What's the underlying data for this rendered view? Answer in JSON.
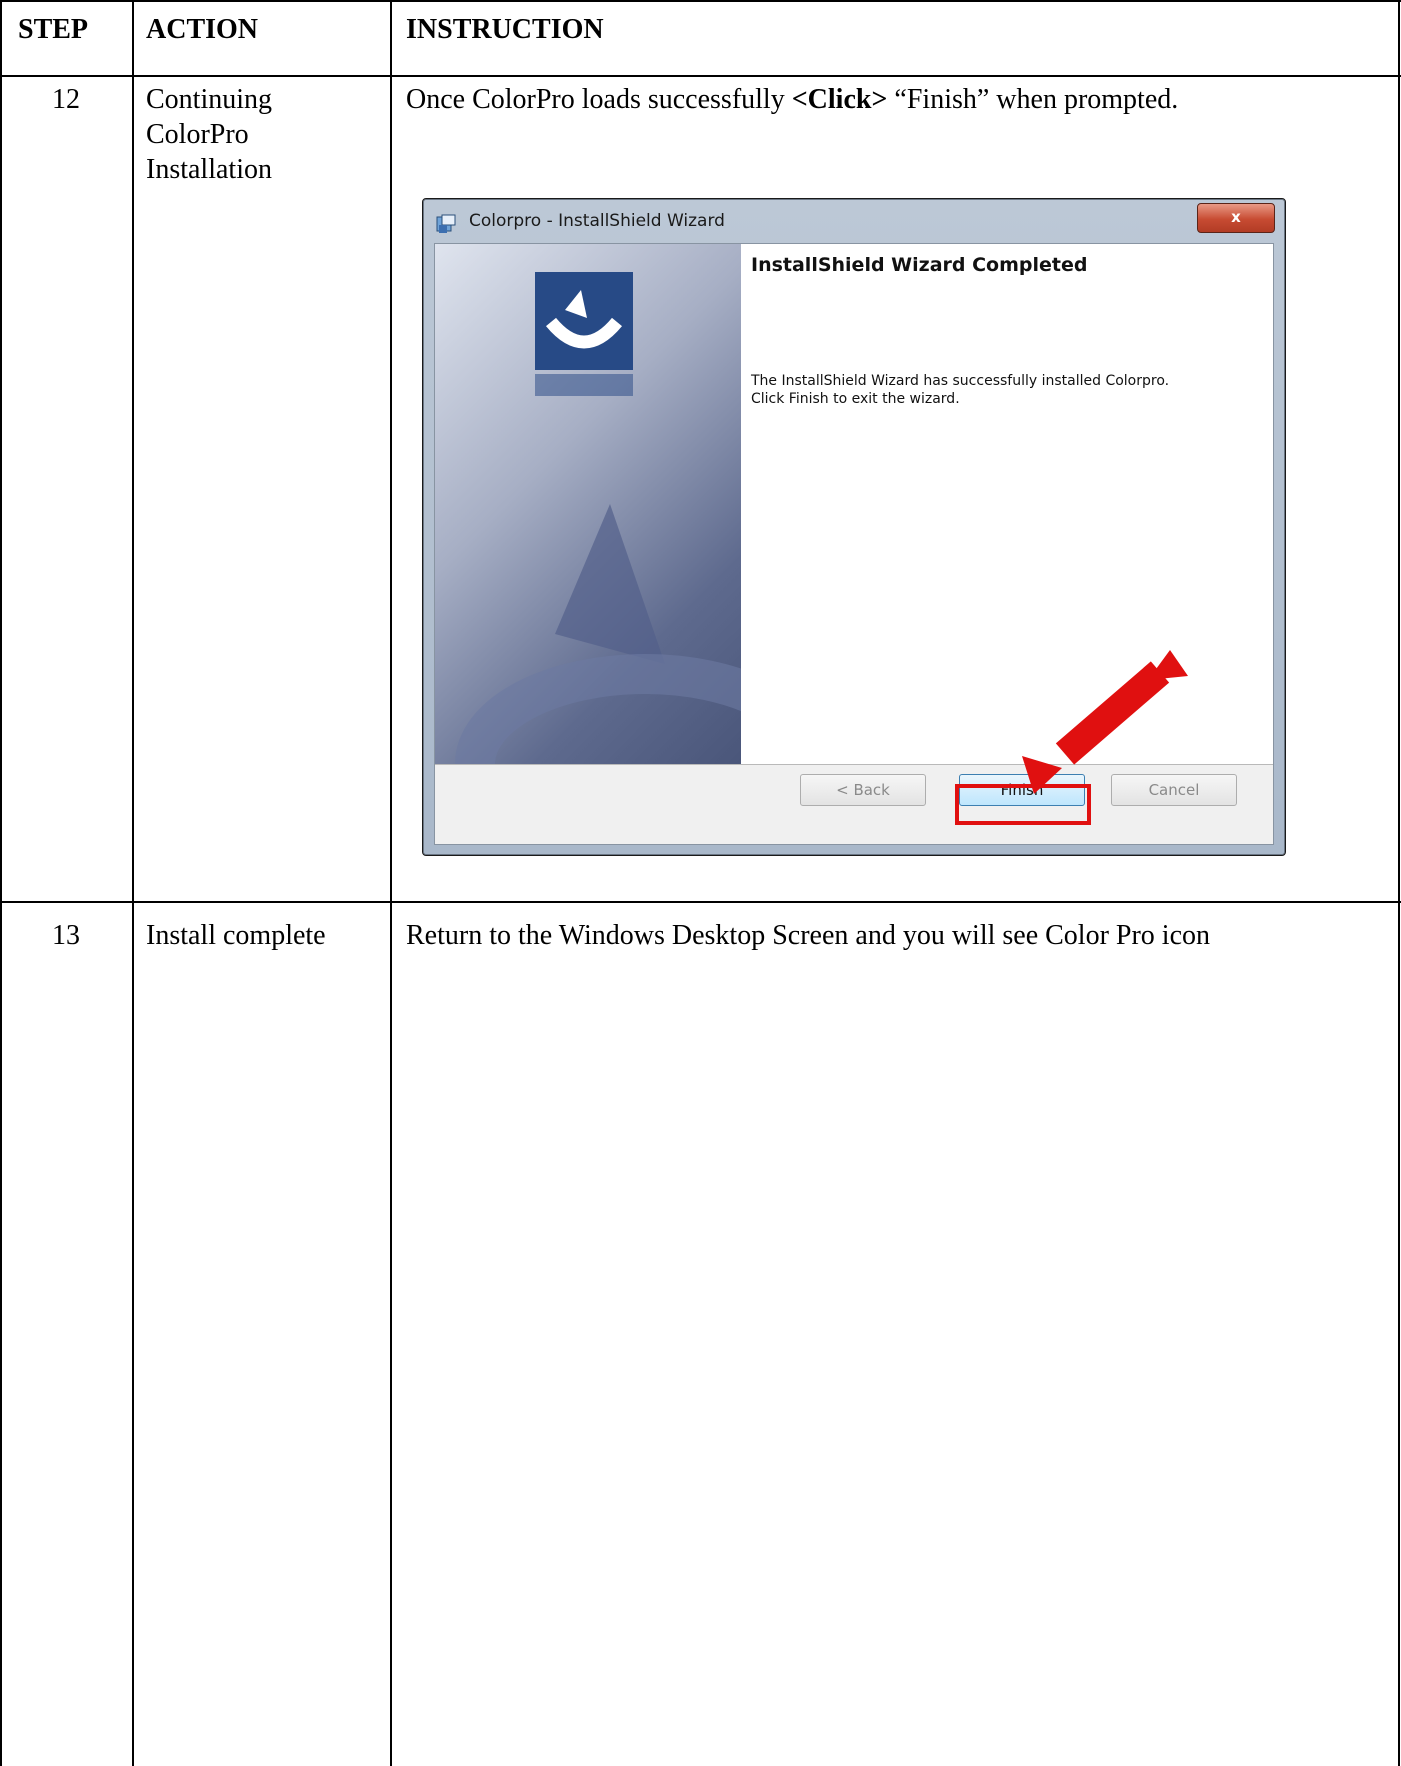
{
  "table": {
    "headers": {
      "step": "STEP",
      "action": "ACTION",
      "instruction": "INSTRUCTION"
    },
    "rows": [
      {
        "step": "12",
        "action_lines": [
          "Continuing",
          "ColorPro",
          "Installation"
        ],
        "instruction_pre": "Once ColorPro loads successfully ",
        "instruction_bold": "<Click>",
        "instruction_post": " “Finish” when prompted."
      },
      {
        "step": "13",
        "action_lines": [
          "Install complete"
        ],
        "instruction": "Return to the Windows Desktop Screen and you will see Color Pro icon"
      }
    ]
  },
  "dialog": {
    "title": "Colorpro - InstallShield Wizard",
    "close_label": "x",
    "heading": "InstallShield Wizard Completed",
    "message_line1": "The InstallShield Wizard has successfully installed Colorpro.",
    "message_line2": "Click Finish to exit the wizard.",
    "back_label": "< Back",
    "finish_label": "Finish",
    "cancel_label": "Cancel",
    "highlight_color": "#e01010",
    "arrow_color": "#e01010"
  }
}
